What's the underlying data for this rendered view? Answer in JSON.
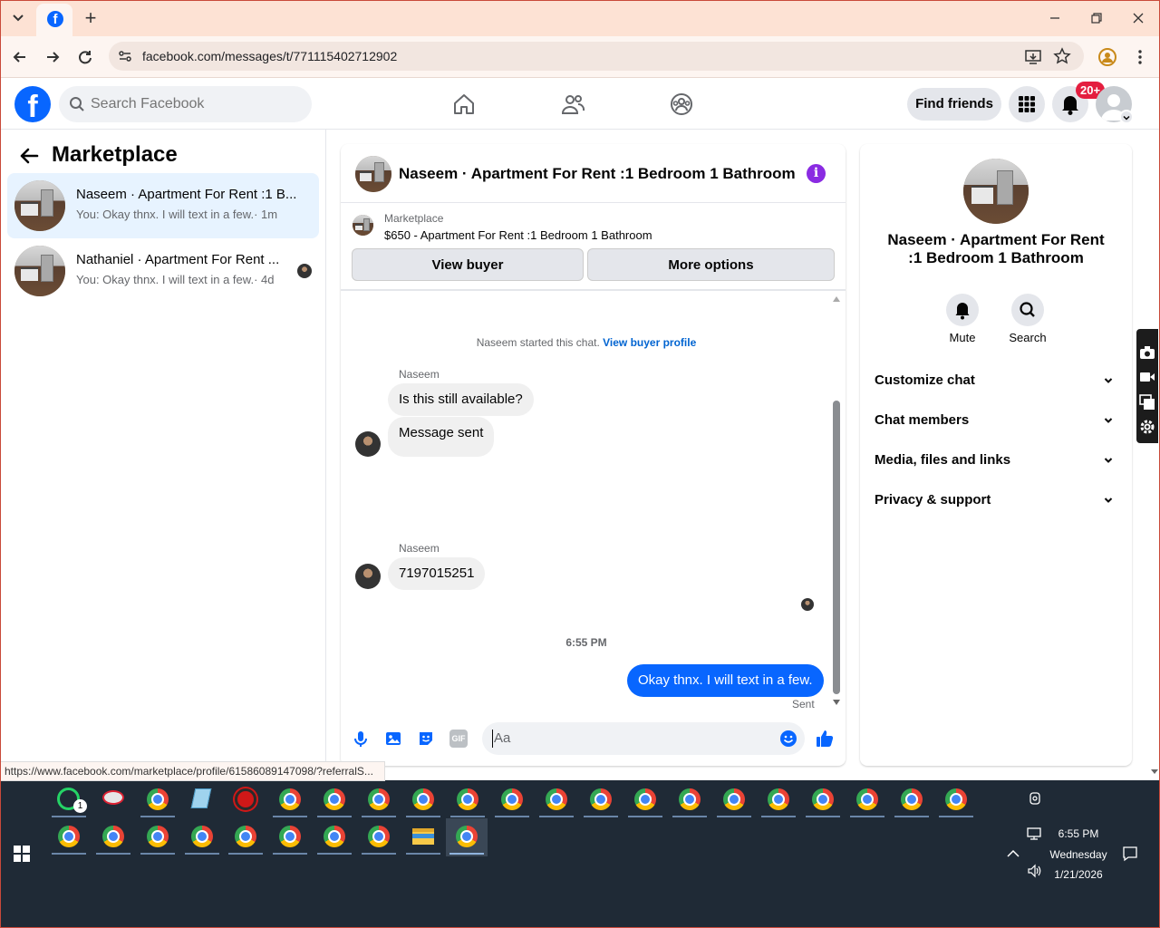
{
  "browser": {
    "tab_icon": "facebook-icon",
    "url": "facebook.com/messages/t/771115402712902",
    "status_url": "https://www.facebook.com/marketplace/profile/61586089147098/?referralS..."
  },
  "header": {
    "search_placeholder": "Search Facebook",
    "find_friends": "Find friends",
    "notif_count": "20+"
  },
  "left": {
    "title": "Marketplace",
    "conversations": [
      {
        "title": "Naseem · Apartment For Rent :1 B...",
        "preview": "You: Okay thnx. I will text in a few.",
        "time": "· 1m"
      },
      {
        "title": "Nathaniel · Apartment For Rent ...",
        "preview": "You: Okay thnx. I will text in a few.",
        "time": "· 4d"
      }
    ]
  },
  "chat": {
    "title": "Naseem · Apartment For Rent :1 Bedroom 1 Bathroom",
    "listing_label": "Marketplace",
    "listing_text": "$650 - Apartment For Rent :1 Bedroom 1 Bathroom",
    "view_buyer": "View buyer",
    "more_options": "More options",
    "started_text": "Naseem started this chat.",
    "view_profile_link": "View buyer profile",
    "sender_name_1": "Naseem",
    "msg_1": "Is this still available?",
    "msg_2": "Message sent",
    "sender_name_2": "Naseem",
    "msg_3": "7197015251",
    "timestamp": "6:55 PM",
    "my_msg": "Okay thnx. I will text in a few.",
    "sent_label": "Sent",
    "composer_placeholder": "Aa",
    "gif_label": "GIF"
  },
  "info": {
    "title": "Naseem · Apartment For Rent :1 Bedroom 1 Bathroom",
    "mute": "Mute",
    "search": "Search",
    "sections": [
      "Customize chat",
      "Chat members",
      "Media, files and links",
      "Privacy & support"
    ]
  },
  "taskbar": {
    "time": "6:55 PM",
    "day": "Wednesday",
    "date": "1/21/2026",
    "whatsapp_badge": "1"
  },
  "colors": {
    "fb_blue": "#0866ff",
    "link_blue": "#0064d1",
    "purple_info": "#8a2be2",
    "notif_red": "#e41e3f",
    "taskbar": "#1f2a36"
  }
}
